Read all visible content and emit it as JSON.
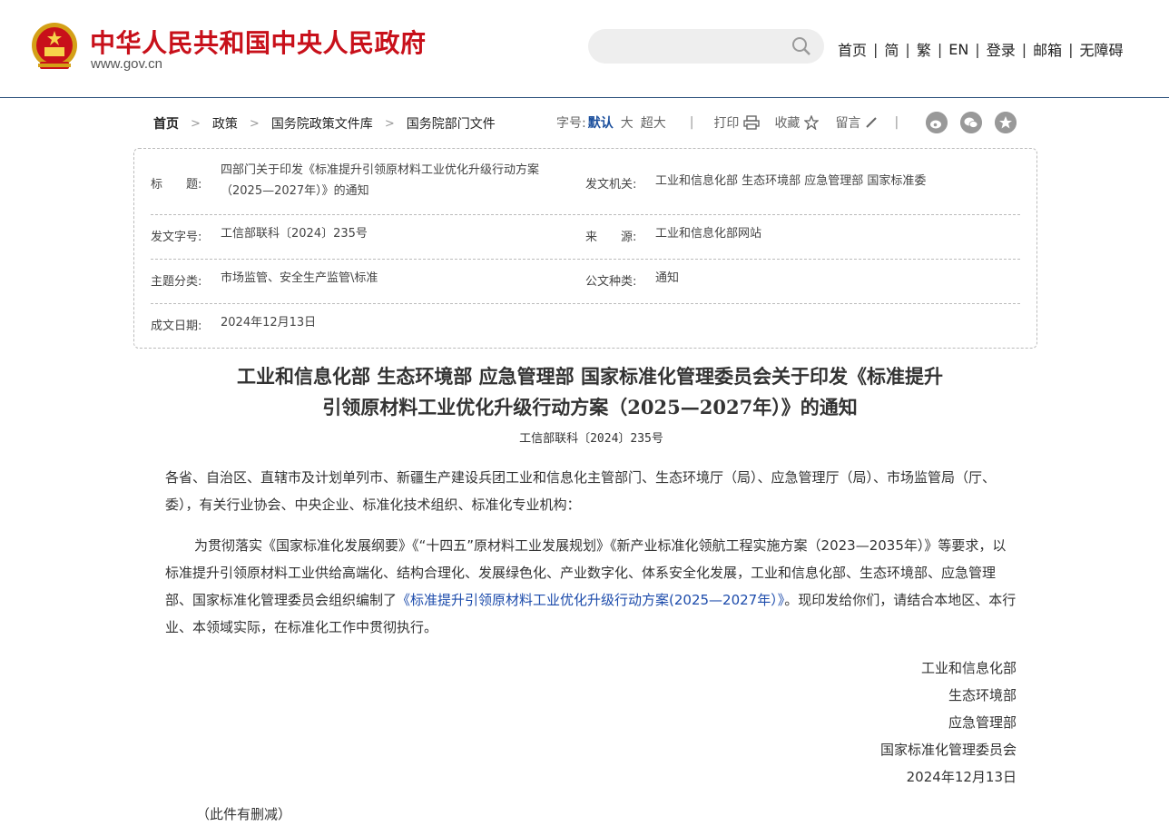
{
  "header": {
    "site_title": "中华人民共和国中央人民政府",
    "site_url": "www.gov.cn",
    "search": {
      "placeholder": ""
    },
    "nav": [
      "首页",
      "简",
      "繁",
      "EN",
      "登录",
      "邮箱",
      "无障碍"
    ]
  },
  "breadcrumb": [
    "首页",
    "政策",
    "国务院政策文件库",
    "国务院部门文件"
  ],
  "tools": {
    "font_size_label": "字号:",
    "font_default": "默认",
    "font_large": "大",
    "font_xlarge": "超大",
    "print": "打印",
    "favorite": "收藏",
    "comment": "留言"
  },
  "info": {
    "title_label": "标　　题:",
    "title_value": "四部门关于印发《标准提升引领原材料工业优化升级行动方案（2025—2027年）》的通知",
    "issuer_label": "发文机关:",
    "issuer_value": "工业和信息化部 生态环境部 应急管理部 国家标准委",
    "docno_label": "发文字号:",
    "docno_value": "工信部联科〔2024〕235号",
    "source_label": "来　　源:",
    "source_value": "工业和信息化部网站",
    "topic_label": "主题分类:",
    "topic_value": "市场监管、安全生产监管\\标准",
    "type_label": "公文种类:",
    "type_value": "通知",
    "date_label": "成文日期:",
    "date_value": "2024年12月13日"
  },
  "article": {
    "title_line1": "工业和信息化部 生态环境部 应急管理部 国家标准化管理委员会关于印发《标准提升",
    "title_line2": "引领原材料工业优化升级行动方案（2025—2027年）》的通知",
    "doc_no": "工信部联科〔2024〕235号",
    "addressee": "各省、自治区、直辖市及计划单列市、新疆生产建设兵团工业和信息化主管部门、生态环境厅（局）、应急管理厅（局）、市场监管局（厅、委），有关行业协会、中央企业、标准化技术组织、标准化专业机构：",
    "body_before_link": "为贯彻落实《国家标准化发展纲要》《“十四五”原材料工业发展规划》《新产业标准化领航工程实施方案（2023—2035年）》等要求，以标准提升引领原材料工业供给高端化、结构合理化、发展绿色化、产业数字化、体系安全化发展，工业和信息化部、生态环境部、应急管理部、国家标准化管理委员会组织编制了",
    "body_link": "《标准提升引领原材料工业优化升级行动方案(2025—2027年）》",
    "body_after_link": "。现印发给你们，请结合本地区、本行业、本领域实际，在标准化工作中贯彻执行。",
    "signatories": [
      "工业和信息化部",
      "生态环境部",
      "应急管理部",
      "国家标准化管理委员会"
    ],
    "sign_date": "2024年12月13日",
    "note": "（此件有删减）"
  },
  "colors": {
    "brand_red": "#c8101a",
    "link_blue": "#1c4bab",
    "accent_blue": "#1a4e9c"
  }
}
